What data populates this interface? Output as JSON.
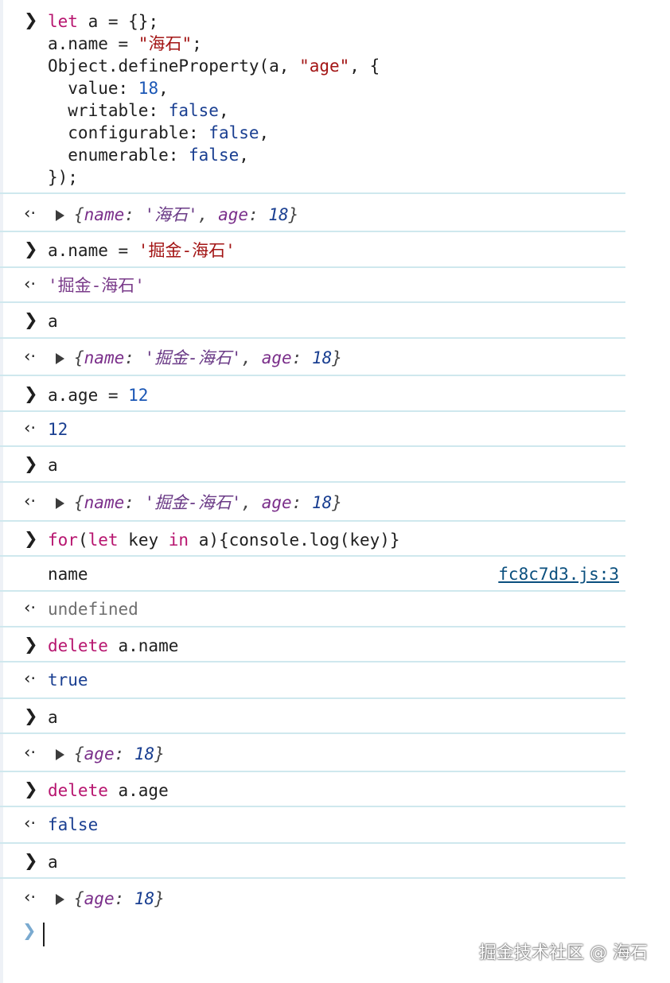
{
  "console": {
    "block1": {
      "l1": {
        "kw": "let",
        "rest1": " a = {};"
      },
      "l2": {
        "pre": "a.name = ",
        "str": "\"海石\"",
        "post": ";"
      },
      "l3": {
        "pre": "Object.defineProperty(a, ",
        "str": "\"age\"",
        "post": ", {"
      },
      "l4": {
        "pre": "  value: ",
        "num": "18",
        "post": ","
      },
      "l5": {
        "pre": "  writable: ",
        "val": "false",
        "post": ","
      },
      "l6": {
        "pre": "  configurable: ",
        "val": "false",
        "post": ","
      },
      "l7": {
        "pre": "  enumerable: ",
        "val": "false",
        "post": ","
      },
      "l8": "});"
    },
    "r1": {
      "open": "{",
      "k1": "name",
      "c1": ": ",
      "v1": "'海石'",
      "sep": ", ",
      "k2": "age",
      "c2": ": ",
      "v2": "18",
      "close": "}"
    },
    "i2": {
      "pre": "a.name = ",
      "str": "'掘金-海石'"
    },
    "r2": "'掘金-海石'",
    "i3": "a",
    "r3": {
      "open": "{",
      "k1": "name",
      "c1": ": ",
      "v1": "'掘金-海石'",
      "sep": ", ",
      "k2": "age",
      "c2": ": ",
      "v2": "18",
      "close": "}"
    },
    "i4": {
      "pre": "a.age = ",
      "num": "12"
    },
    "r4": "12",
    "i5": "a",
    "r5": {
      "open": "{",
      "k1": "name",
      "c1": ": ",
      "v1": "'掘金-海石'",
      "sep": ", ",
      "k2": "age",
      "c2": ": ",
      "v2": "18",
      "close": "}"
    },
    "i6": {
      "kw1": "for",
      "p1": "(",
      "kw2": "let",
      "p2": " key ",
      "kw3": "in",
      "p3": " a){console.log(key)}"
    },
    "log6": {
      "text": "name",
      "source": "fc8c7d3.js:3"
    },
    "r6": "undefined",
    "i7": {
      "kw": "delete",
      "rest": " a.name"
    },
    "r7": "true",
    "i8": "a",
    "r8": {
      "open": "{",
      "k": "age",
      "c": ": ",
      "v": "18",
      "close": "}"
    },
    "i9": {
      "kw": "delete",
      "rest": " a.age"
    },
    "r9": "false",
    "i10": "a",
    "r10": {
      "open": "{",
      "k": "age",
      "c": ": ",
      "v": "18",
      "close": "}"
    }
  },
  "glyphs": {
    "input_prompt": "❯",
    "result_prompt": "‹·",
    "final_prompt": "❯"
  },
  "watermark": "掘金技术社区 @ 海石",
  "colors": {
    "keyword": "#b7156f",
    "string": "#a31515",
    "number": "#1a56b5",
    "boolean": "#1a3f91",
    "divider": "#cfe8ee",
    "link": "#0a4f7e"
  }
}
